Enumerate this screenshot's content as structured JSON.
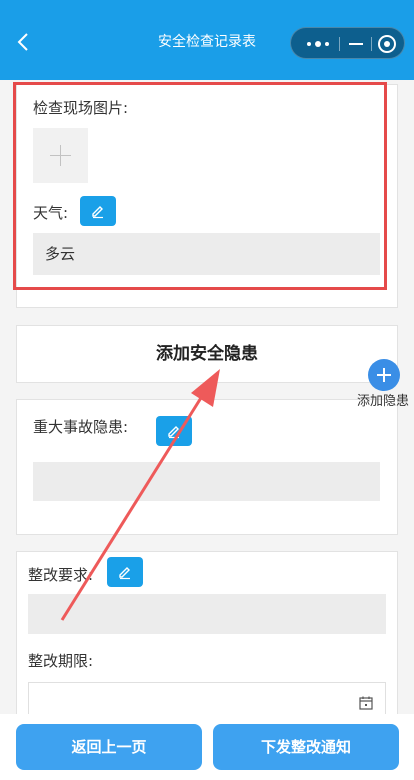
{
  "header": {
    "title": "安全检查记录表",
    "back_icon": "chevron-left-icon",
    "capsule_icons": [
      "more-dots-icon",
      "minimize-icon",
      "target-circle-icon"
    ]
  },
  "inspection": {
    "site_photos_label": "检查现场图片:",
    "weather_label": "天气:",
    "weather_value": "多云"
  },
  "hazard": {
    "add_title": "添加安全隐患",
    "add_button_label": "添加隐患",
    "major_label": "重大事故隐患:",
    "major_value": ""
  },
  "rectification": {
    "requirement_label": "整改要求:",
    "requirement_value": "",
    "deadline_label": "整改期限:",
    "deadline_value": ""
  },
  "footer": {
    "back_button": "返回上一页",
    "issue_button": "下发整改通知"
  },
  "colors": {
    "header_bg": "#1a9ee8",
    "accent": "#1aa0e8",
    "highlight_border": "#e54a4a",
    "annotation_arrow": "#ee5a5a",
    "button_bg": "#3ea2f0"
  }
}
